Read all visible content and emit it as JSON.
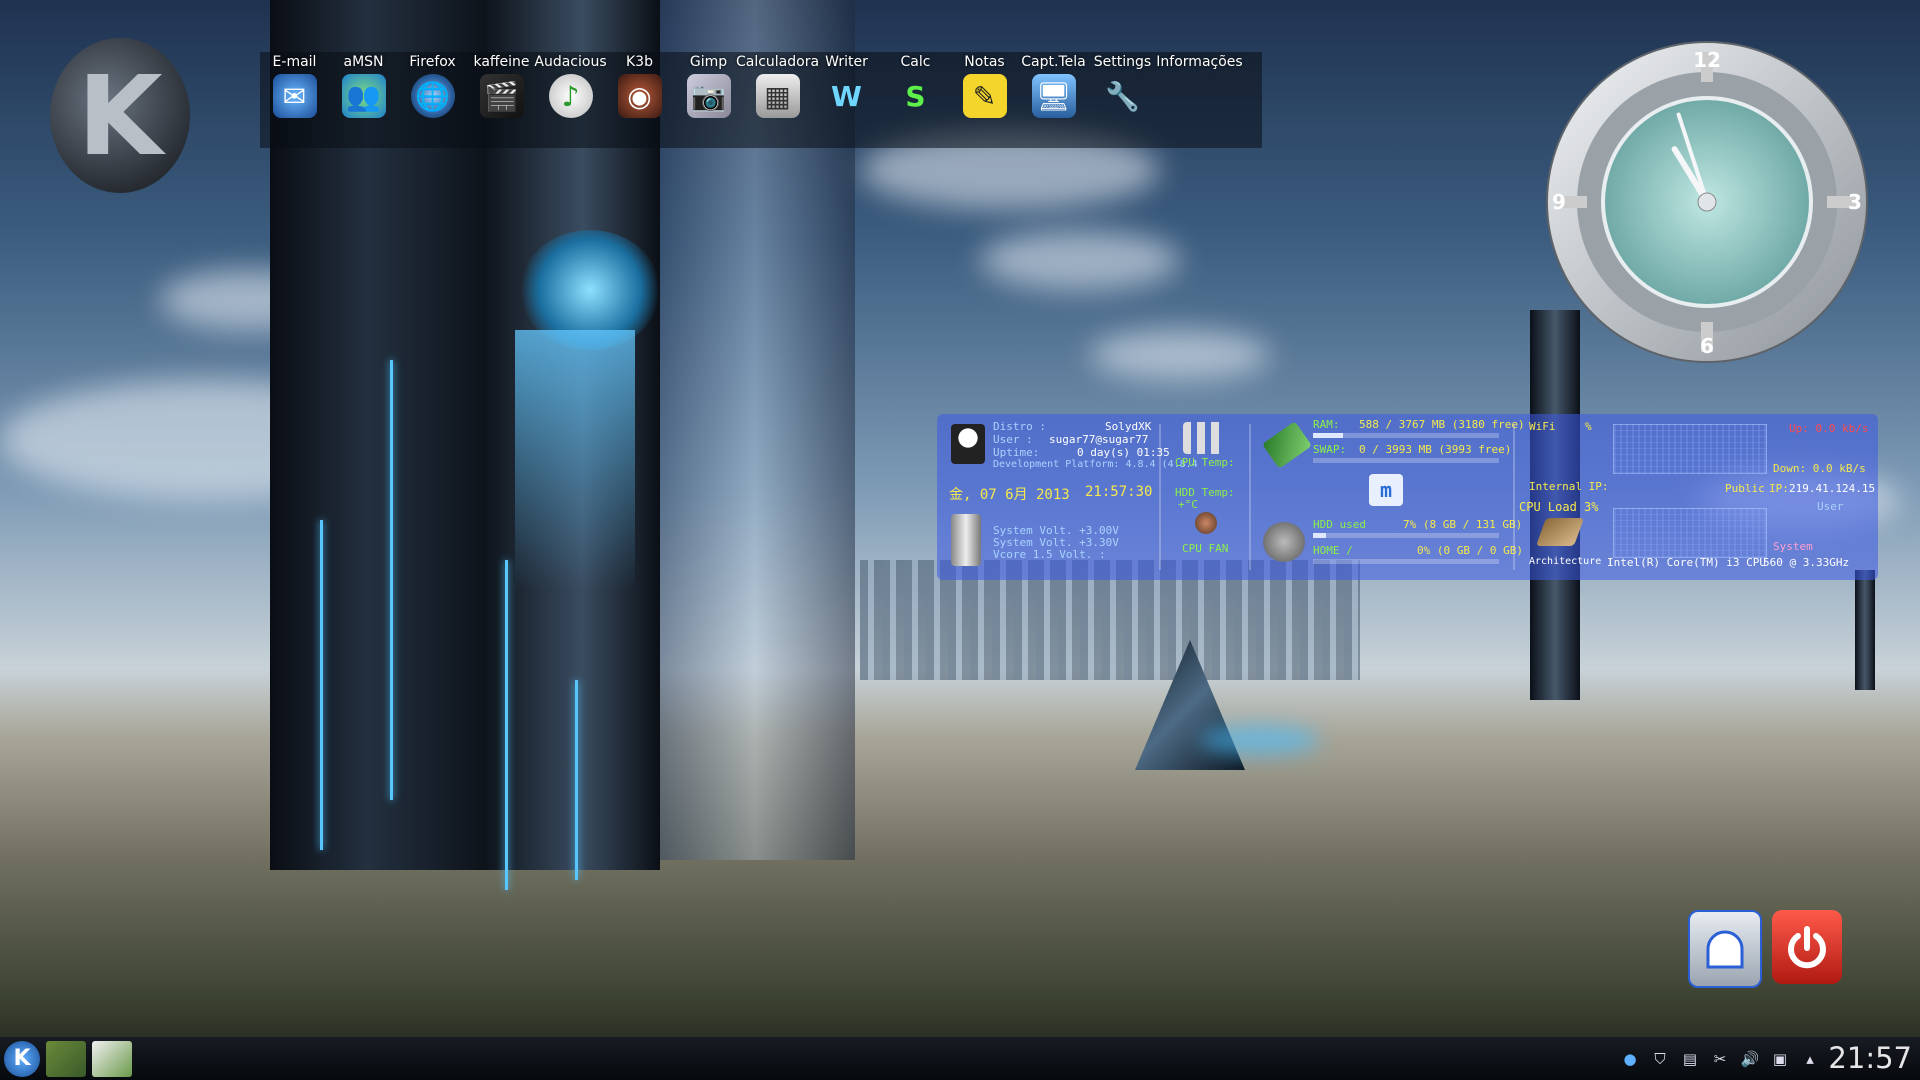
{
  "launcher": {
    "items": [
      {
        "label": "E-mail",
        "icon": "email-icon"
      },
      {
        "label": "aMSN",
        "icon": "amsn-icon"
      },
      {
        "label": "Firefox",
        "icon": "firefox-icon"
      },
      {
        "label": "kaffeine",
        "icon": "kaffeine-icon"
      },
      {
        "label": "Audacious",
        "icon": "audacious-icon"
      },
      {
        "label": "K3b",
        "icon": "k3b-icon"
      },
      {
        "label": "Gimp",
        "icon": "gimp-icon"
      },
      {
        "label": "Calculadora",
        "icon": "calculator-icon"
      },
      {
        "label": "Writer",
        "icon": "writer-icon"
      },
      {
        "label": "Calc",
        "icon": "calc-icon"
      },
      {
        "label": "Notas",
        "icon": "notes-icon"
      },
      {
        "label": "Capt.Tela",
        "icon": "screenshot-icon"
      },
      {
        "label": "Settings",
        "icon": "settings-icon"
      },
      {
        "label": "Informações",
        "icon": "info-icon"
      }
    ]
  },
  "clock": {
    "n12": "12",
    "n3": "3",
    "n6": "6",
    "n9": "9",
    "hour": 10,
    "minute": 57
  },
  "conky": {
    "distro_label": "Distro :",
    "distro_value": "SolydXK",
    "user_label": "User :",
    "user_value": "sugar77@sugar77",
    "uptime_label": "Uptime:",
    "uptime_value": "0 day(s)  01:35",
    "devplat": "Development Platform: 4.8.4 (4.8.4",
    "date": "金, 07  6月 2013",
    "time": "21:57:30",
    "sysvolt1": "System Volt. +3.00V",
    "sysvolt2": "System Volt. +3.30V",
    "vcore": "Vcore 1.5 Volt. :",
    "cputemp": "CPU Temp:",
    "hddtemp": "HDD Temp:",
    "hddtemp_val": "+°C",
    "cpufan": "CPU FAN",
    "ram_label": "RAM:",
    "ram_value": "588 / 3767 MB (3180 free)",
    "ram_fill": 0.16,
    "swap_label": "SWAP:",
    "swap_value": "0 / 3993 MB (3993 free)",
    "swap_fill": 0.0,
    "hdd_label": "HDD used",
    "hdd_value": "7% (8 GB / 131 GB)",
    "hdd_fill": 0.07,
    "home_label": "HOME /",
    "home_value": "0% (0 GB / 0 GB)",
    "home_fill": 0.0,
    "wifi_label": "WiFi",
    "wifi_pct": "%",
    "internal_ip": "Internal IP:",
    "cpu_load": "CPU Load 3%",
    "architecture": "Architecture :",
    "cpu_model": "Intel(R) Core(TM) i3 CPU",
    "cpu_model2": "560  @ 3.33GHz",
    "up": "Up: 0.0 kb/s",
    "down": "Down: 0.0 kB/s",
    "public": "Public",
    "ip_label": "IP:",
    "public_ip": "219.41.124.15",
    "user_graph": "User",
    "system_graph": "System"
  },
  "taskbar": {
    "clock": "21:57"
  },
  "colors": {
    "conky_bg": "#3c5ae6",
    "yellow": "#f6e94d",
    "green": "#8cf04a",
    "red": "#ff4a4a",
    "lock": "#c8ccd2",
    "logout": "#e02a2a"
  }
}
